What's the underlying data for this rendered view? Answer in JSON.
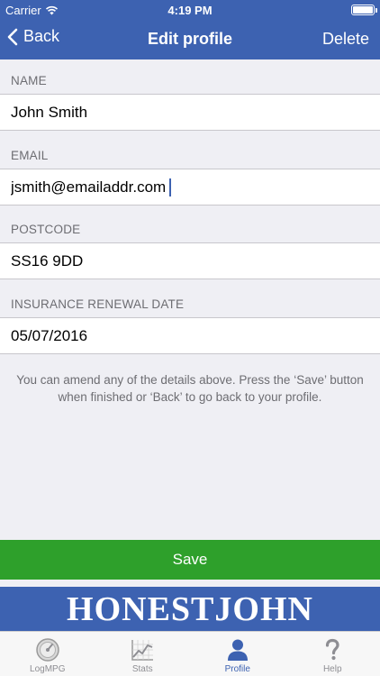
{
  "status_bar": {
    "carrier": "Carrier",
    "time": "4:19 PM"
  },
  "navbar": {
    "back_label": "Back",
    "title": "Edit profile",
    "delete_label": "Delete"
  },
  "form": {
    "name": {
      "label": "NAME",
      "value": "John Smith"
    },
    "email": {
      "label": "EMAIL",
      "value": "jsmith@emailaddr.com"
    },
    "postcode": {
      "label": "POSTCODE",
      "value": "SS16 9DD"
    },
    "renewal": {
      "label": "INSURANCE RENEWAL DATE",
      "value": "05/07/2016"
    }
  },
  "info_text": "You can amend any of the details above.  Press the ‘Save’ button when finished or ‘Back’ to go back to your profile.",
  "save_label": "Save",
  "brand_banner": "HONESTJOHN",
  "tabs": [
    {
      "label": "LogMPG",
      "icon": "gauge-icon"
    },
    {
      "label": "Stats",
      "icon": "chart-icon"
    },
    {
      "label": "Profile",
      "icon": "person-icon",
      "active": true
    },
    {
      "label": "Help",
      "icon": "question-icon"
    }
  ],
  "colors": {
    "brand_blue": "#3d62b1",
    "save_green": "#2ea02b",
    "background": "#efeff4"
  }
}
